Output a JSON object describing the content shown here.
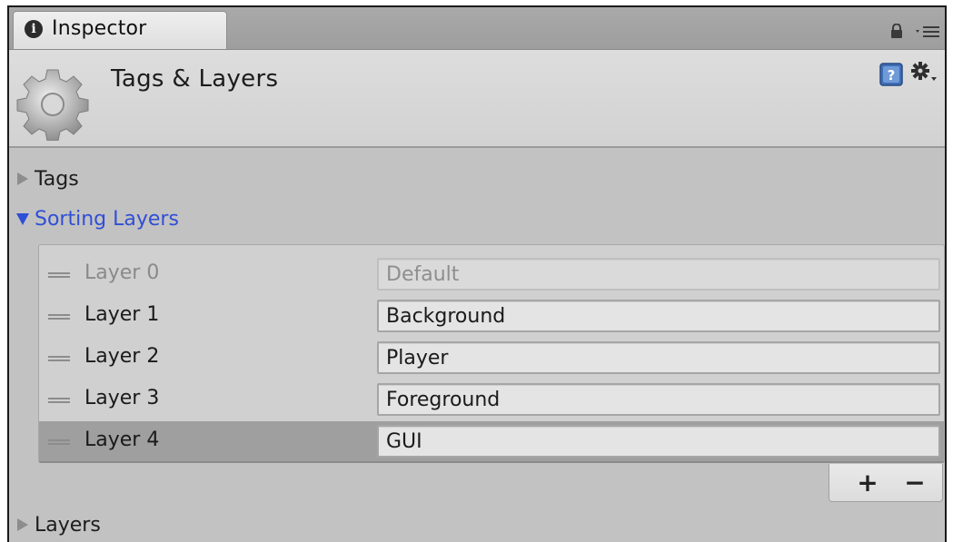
{
  "tab": {
    "title": "Inspector",
    "info_glyph": "i"
  },
  "header": {
    "title": "Tags & Layers"
  },
  "foldouts": {
    "tags": {
      "label": "Tags"
    },
    "sorting_layers": {
      "label": "Sorting Layers"
    },
    "layers": {
      "label": "Layers"
    }
  },
  "sorting_layers": {
    "rows": [
      {
        "label": "Layer 0",
        "value": "Default",
        "disabled": true,
        "selected": false
      },
      {
        "label": "Layer 1",
        "value": "Background",
        "disabled": false,
        "selected": false
      },
      {
        "label": "Layer 2",
        "value": "Player",
        "disabled": false,
        "selected": false
      },
      {
        "label": "Layer 3",
        "value": "Foreground",
        "disabled": false,
        "selected": false
      },
      {
        "label": "Layer 4",
        "value": "GUI",
        "disabled": false,
        "selected": true
      }
    ],
    "add_label": "+",
    "remove_label": "−"
  },
  "icons": {
    "tab": "info-icon",
    "lock": "lock-icon",
    "menu": "menu-icon",
    "header": "gear-icon",
    "help": "help-icon",
    "settings": "settings-icon",
    "collapsed": "triangle-right-icon",
    "expanded": "triangle-down-icon",
    "drag": "drag-handle-icon"
  },
  "colors": {
    "panel": "#c2c2c2",
    "foldout_active": "#2f4fd6",
    "selected_row": "#9f9f9f"
  }
}
